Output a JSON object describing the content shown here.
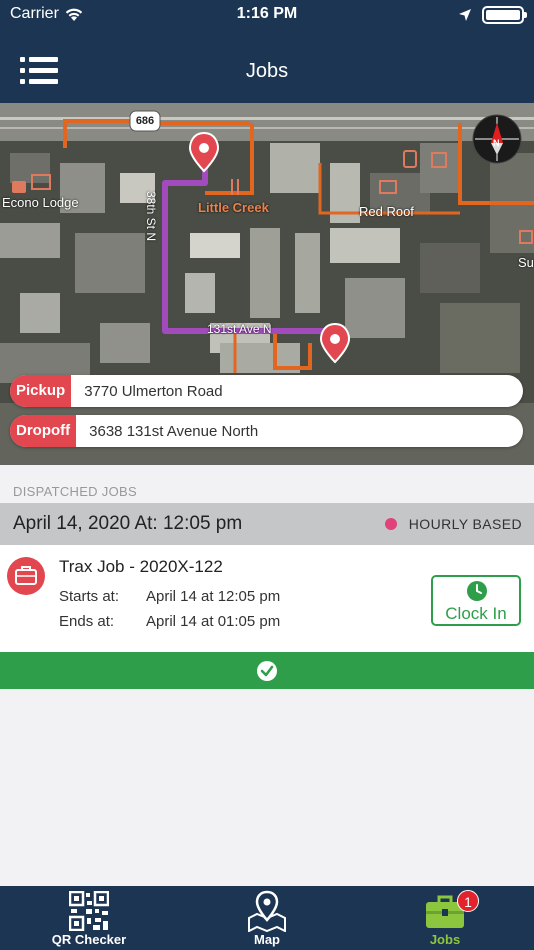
{
  "status_bar": {
    "carrier": "Carrier",
    "time": "1:16 PM"
  },
  "nav": {
    "title": "Jobs"
  },
  "map": {
    "labels": {
      "road_shield": "686",
      "econo_lodge": "Econo Lodge",
      "little_creek": "Little Creek",
      "red_roof": "Red Roof",
      "street_vertical": "38th St N",
      "street_horizontal": "131st Ave N",
      "edge": "Su"
    },
    "pickup": {
      "badge": "Pickup",
      "address": "3770 Ulmerton Road"
    },
    "dropoff": {
      "badge": "Dropoff",
      "address": "3638 131st Avenue North"
    }
  },
  "jobs": {
    "section_label": "DISPATCHED JOBS",
    "date_header": "April 14, 2020 At: 12:05 pm",
    "job_type": "HOURLY BASED",
    "job": {
      "title": "Trax Job - 2020X-122",
      "starts_label": "Starts at:",
      "starts_value": "April 14 at 12:05 pm",
      "ends_label": "Ends at:",
      "ends_value": "April 14 at 01:05 pm",
      "clock_in_label": "Clock In"
    }
  },
  "tabs": [
    {
      "label": "QR Checker"
    },
    {
      "label": "Map"
    },
    {
      "label": "Jobs",
      "badge": "1"
    }
  ],
  "colors": {
    "nav_bg": "#1c3553",
    "accent_red": "#e2464f",
    "accent_green": "#2e9e4b",
    "active_tab": "#8cc63f",
    "route": "#a24bbd",
    "job_dot": "#e0427a"
  }
}
